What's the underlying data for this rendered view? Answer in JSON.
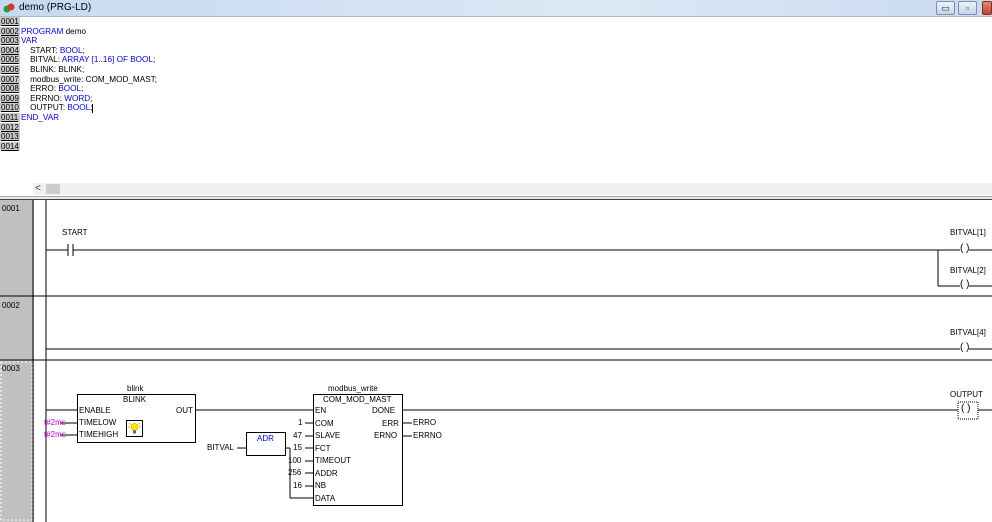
{
  "window": {
    "title": "demo (PRG-LD)",
    "buttons": [
      "▭",
      "▫",
      ""
    ]
  },
  "declaration": {
    "line_numbers": [
      "0001",
      "0002",
      "0003",
      "0004",
      "0005",
      "0006",
      "0007",
      "0008",
      "0009",
      "0010",
      "0011",
      "0012",
      "0013",
      "0014"
    ],
    "lines": [
      {
        "kw": "PROGRAM",
        "text": " demo"
      },
      {
        "kw": "VAR",
        "text": ""
      },
      {
        "pre": "    START: ",
        "kw": "BOOL",
        "text": ";"
      },
      {
        "pre": "    BITVAL: ",
        "kw": "ARRAY [1..16] OF BOOL",
        "text": ";"
      },
      {
        "pre": "    BLINK: BLINK;",
        "kw": "",
        "text": ""
      },
      {
        "pre": "    modbus_write: COM_MOD_MAST;",
        "kw": "",
        "text": ""
      },
      {
        "pre": "    ERRO: ",
        "kw": "BOOL",
        "text": ";"
      },
      {
        "pre": "    ERRNO: ",
        "kw": "WORD",
        "text": ";"
      },
      {
        "pre": "    OUTPUT: ",
        "kw": "BOOL",
        "text": ";"
      },
      {
        "kw": "END_VAR",
        "text": ""
      }
    ],
    "scroll_arrow": "<"
  },
  "ladder": {
    "networks": [
      "0001",
      "0002",
      "0003"
    ],
    "net1": {
      "contact": "START",
      "coil1": "BITVAL[1]",
      "coil2": "BITVAL[2]",
      "coil_symbol": "( )"
    },
    "net2": {
      "coil": "BITVAL[4]",
      "coil_symbol": "( )"
    },
    "net3": {
      "blink_instance": "blink",
      "blink_type": "BLINK",
      "blink_in": [
        "ENABLE",
        "TIMELOW",
        "TIMEHIGH"
      ],
      "blink_out": "OUT",
      "blink_params": [
        "t#2ms",
        "t#2ms"
      ],
      "mb_instance": "modbus_write",
      "mb_type": "COM_MOD_MAST",
      "mb_in": [
        "EN",
        "COM",
        "SLAVE",
        "FCT",
        "TIMEOUT",
        "ADDR",
        "NB",
        "DATA"
      ],
      "mb_in_vals": [
        "1",
        "47",
        "15",
        "100",
        "256",
        "16"
      ],
      "mb_out": [
        "DONE",
        "ERR",
        "ERNO"
      ],
      "mb_out_vars": [
        "ERRO",
        "ERRNO"
      ],
      "adr_box": "ADR",
      "adr_in": "BITVAL",
      "coil": "OUTPUT",
      "coil_symbol": "( )"
    }
  }
}
